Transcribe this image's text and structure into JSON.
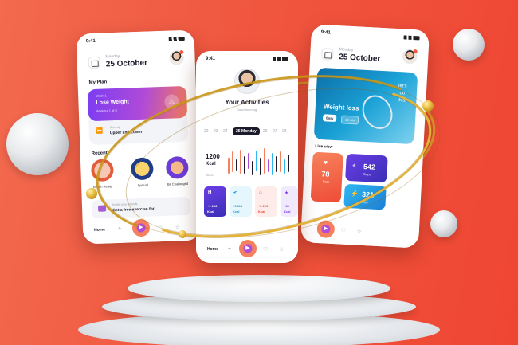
{
  "colors": {
    "background": "#f0563f",
    "accent_purple": "#7b3df2",
    "accent_orange": "#f4805e",
    "gold": "#d9a628"
  },
  "left_phone": {
    "time": "9:41",
    "day": "Monday",
    "date": "25 October",
    "my_plan_label": "My Plan",
    "plan": {
      "week": "Week 1",
      "title": "Lose Weight",
      "sub": "Workout 1 of 8",
      "next_label": "Next up",
      "next_title": "Upper and Lower"
    },
    "recent_label": "Recent",
    "recent_items": [
      {
        "label": "Beach Ready",
        "icon": "house-icon"
      },
      {
        "label": "Special",
        "icon": "trophy-icon"
      },
      {
        "label": "Be Challenged",
        "icon": "sparkles-icon"
      }
    ],
    "invite": {
      "line1": "Invite your friends",
      "line2": "Get a free exercise for"
    },
    "nav": {
      "home": "Home"
    }
  },
  "center_phone": {
    "time": "9:41",
    "title": "Your Activities",
    "subtitle": "Good morning!",
    "days": [
      "22",
      "23",
      "24",
      "25 Monday",
      "26",
      "27",
      "28"
    ],
    "selected_day_index": 3,
    "kcal_value": "1200",
    "kcal_unit": "Kcal",
    "time_label": "06:21",
    "metrics": [
      {
        "value": "+1 213",
        "unit": "Kcal",
        "icon": "H",
        "theme": "dark"
      },
      {
        "value": "+6 113",
        "unit": "Kcal",
        "icon": "⟲",
        "theme": "blue"
      },
      {
        "value": "+3 223",
        "unit": "Kcal",
        "icon": "⌂",
        "theme": "red"
      },
      {
        "value": "+63",
        "unit": "Kcal",
        "icon": "✦",
        "theme": "purple"
      }
    ],
    "nav": {
      "home": "Home"
    }
  },
  "right_phone": {
    "time": "9:41",
    "day": "Monday",
    "date": "25 October",
    "hero": {
      "title": "Weight loss",
      "quote": "let's do this!",
      "difficulty": "Easy",
      "duration": "12 min"
    },
    "live_label": "Live view",
    "tiles": [
      {
        "value": "78",
        "label": "Rate",
        "icon": "heart-icon"
      },
      {
        "value": "542",
        "label": "Steps",
        "icon": "location-icon"
      },
      {
        "value": "321",
        "label": "Kcal",
        "icon": "activity-icon"
      }
    ]
  }
}
